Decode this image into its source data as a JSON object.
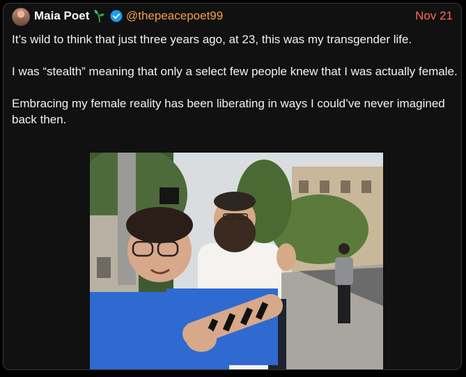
{
  "tweet": {
    "author_name": "Maia Poet",
    "author_handle": "@thepeacepoet99",
    "date": "Nov 21",
    "paragraphs": [
      "It’s wild to think that just three years ago, at 23, this was my transgender life.",
      "I was “stealth” meaning that only a select few people knew that I was actually female.",
      "Embracing my female reality has been liberating in ways I could’ve never imagined back then."
    ],
    "icons": {
      "name_emoji": "seedling-icon",
      "verified": "verified-badge-icon"
    },
    "colors": {
      "background": "#111111",
      "handle": "#f4a04a",
      "date": "#ff6b57",
      "verified": "#1d9bf0"
    }
  }
}
